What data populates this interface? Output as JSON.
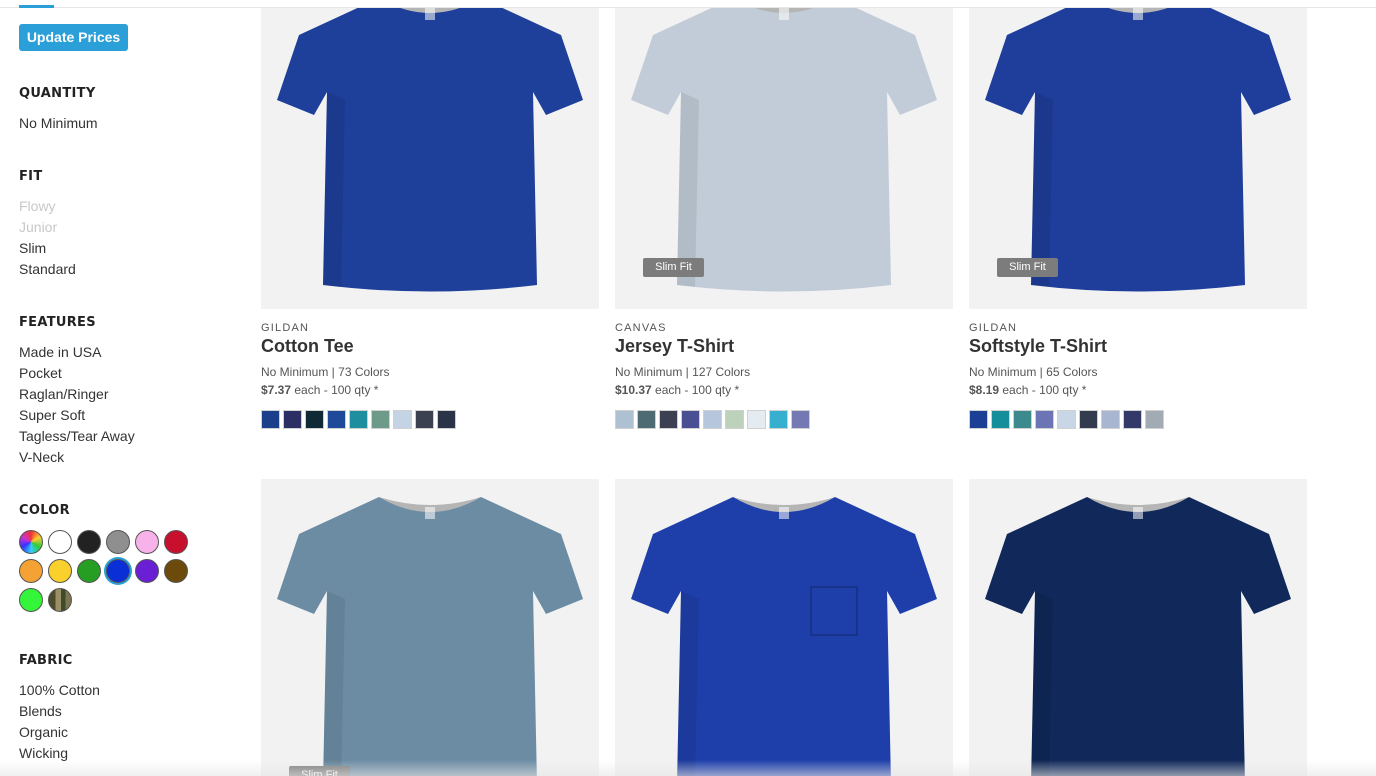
{
  "sidebar": {
    "update_button": "Update Prices",
    "quantity": {
      "title": "QUANTITY",
      "items": [
        "No Minimum"
      ]
    },
    "fit": {
      "title": "FIT",
      "items": [
        "Flowy",
        "Junior",
        "Slim",
        "Standard"
      ],
      "disabled": [
        true,
        true,
        false,
        false
      ]
    },
    "features": {
      "title": "FEATURES",
      "items": [
        "Made in USA",
        "Pocket",
        "Raglan/Ringer",
        "Super Soft",
        "Tagless/Tear Away",
        "V-Neck"
      ]
    },
    "color": {
      "title": "COLOR",
      "swatches": [
        {
          "name": "multi",
          "hex": "rainbow"
        },
        {
          "name": "white",
          "hex": "#ffffff"
        },
        {
          "name": "black",
          "hex": "#222222"
        },
        {
          "name": "gray",
          "hex": "#8f8f8f"
        },
        {
          "name": "pink",
          "hex": "#f7b2ea"
        },
        {
          "name": "red",
          "hex": "#c8102e"
        },
        {
          "name": "orange",
          "hex": "#f4a234"
        },
        {
          "name": "yellow",
          "hex": "#f9d02c"
        },
        {
          "name": "green",
          "hex": "#269e23"
        },
        {
          "name": "blue",
          "hex": "#0b2fd6",
          "selected": true
        },
        {
          "name": "purple",
          "hex": "#6b1fd4"
        },
        {
          "name": "brown",
          "hex": "#6b4a0c"
        },
        {
          "name": "lime",
          "hex": "#35f53a"
        },
        {
          "name": "camo",
          "hex": "camo"
        }
      ]
    },
    "fabric": {
      "title": "FABRIC",
      "items": [
        "100% Cotton",
        "Blends",
        "Organic",
        "Wicking"
      ]
    }
  },
  "products": [
    {
      "brand": "GILDAN",
      "name": "Cotton Tee",
      "min": "No Minimum",
      "colors": "73 Colors",
      "price": "$7.37",
      "each": "each",
      "qty": "100 qty *",
      "badge": "",
      "tee_color": "#1e3f9a",
      "swatches": [
        "#1c3f8c",
        "#2b2f63",
        "#0f2a34",
        "#1f4a9a",
        "#1f8fa0",
        "#6e9a8a",
        "#c4d4e4",
        "#3c4152",
        "#2b3348"
      ]
    },
    {
      "brand": "CANVAS",
      "name": "Jersey T-Shirt",
      "min": "No Minimum",
      "colors": "127 Colors",
      "price": "$10.37",
      "each": "each",
      "qty": "100 qty *",
      "badge": "Slim Fit",
      "tee_color": "#c2ccd8",
      "swatches": [
        "#aec1d2",
        "#4d6b72",
        "#3d4052",
        "#4a4f94",
        "#b6c6dc",
        "#bcd2bb",
        "#e4ecf2",
        "#37b0cf",
        "#7479b4"
      ]
    },
    {
      "brand": "GILDAN",
      "name": "Softstyle T-Shirt",
      "min": "No Minimum",
      "colors": "65 Colors",
      "price": "$8.19",
      "each": "each",
      "qty": "100 qty *",
      "badge": "Slim Fit",
      "tee_color": "#1f3d9a",
      "swatches": [
        "#1c3f96",
        "#158e9b",
        "#3c8a8e",
        "#6d74b6",
        "#c8d6e6",
        "#333b4e",
        "#a8b6d2",
        "#333a6a",
        "#a2aab4"
      ]
    },
    {
      "badge": "Slim Fit",
      "tee_color": "#6c8ca4"
    },
    {
      "badge": "",
      "tee_color": "#1e3faa",
      "pocket": true
    },
    {
      "badge": "",
      "tee_color": "#10295a"
    }
  ]
}
